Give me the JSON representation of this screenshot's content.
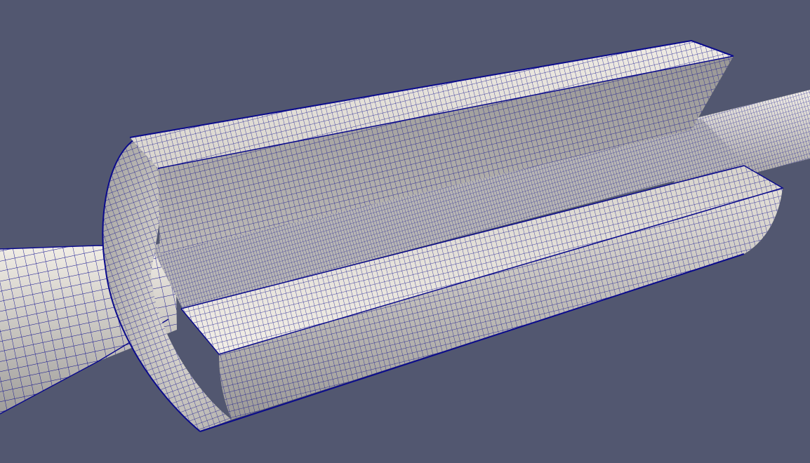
{
  "scene": {
    "background_color": "#525770",
    "surface_color": "#e8e4dc",
    "shadow_color": "#a8a6a4",
    "mesh_color": "#0b0b8c",
    "representation": "surface-with-edges"
  }
}
